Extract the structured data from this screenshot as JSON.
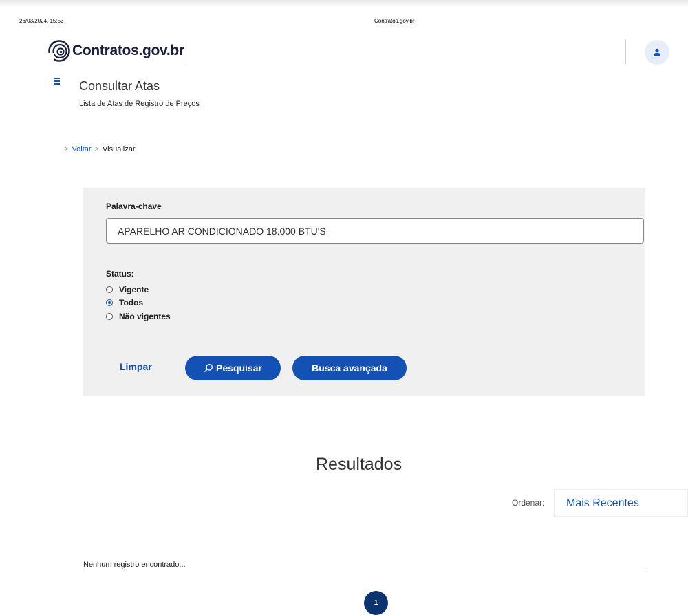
{
  "print_header": {
    "datetime": "26/03/2024, 15:53",
    "site": "Contratos.gov.br"
  },
  "header": {
    "logo_text": "Contratos.gov.br",
    "logo_icon": "gov-swirl-logo",
    "user_icon": "user-icon",
    "brand_color": "#1351b4"
  },
  "page": {
    "title": "Consultar Atas",
    "subtitle": "Lista de Atas de Registro de Preços",
    "menu_icon": "hamburger-menu-icon"
  },
  "breadcrumb": {
    "items": [
      {
        "label": "Voltar",
        "link": true
      },
      {
        "label": "Visualizar",
        "link": false
      }
    ]
  },
  "search": {
    "keyword_label": "Palavra-chave",
    "keyword_value": "APARELHO AR CONDICIONADO 18.000 BTU'S",
    "status_label": "Status:",
    "status_options": [
      {
        "label": "Vigente",
        "checked": false
      },
      {
        "label": "Todos",
        "checked": true
      },
      {
        "label": "Não vigentes",
        "checked": false
      }
    ],
    "clear_label": "Limpar",
    "search_label": "Pesquisar",
    "advanced_label": "Busca avançada"
  },
  "results": {
    "title": "Resultados",
    "order_label": "Ordenar:",
    "order_value": "Mais Recentes",
    "empty_message": "Nenhum registro encontrado...",
    "current_page": "1"
  }
}
